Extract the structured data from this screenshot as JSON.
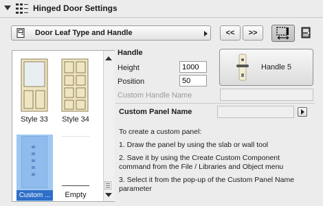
{
  "header": {
    "title": "Hinged Door Settings",
    "icon": "settings-grid-icon"
  },
  "panel": {
    "selected": "Door Leaf Type and Handle",
    "prev_label": "<<",
    "next_label": ">>"
  },
  "styles": {
    "items": [
      {
        "label": "Style 33"
      },
      {
        "label": "Style 34"
      },
      {
        "label": "Custom ..."
      },
      {
        "label": "Empty"
      }
    ],
    "selected_index": 2
  },
  "handle": {
    "section_title": "Handle",
    "height_label": "Height",
    "height_value": "1000",
    "position_label": "Position",
    "position_value": "50",
    "custom_name_label": "Custom Handle Name",
    "custom_name_value": "",
    "preview_label": "Handle 5"
  },
  "custom_panel": {
    "title": "Custom Panel Name",
    "value": "",
    "intro": "To create a custom panel:",
    "step1": "1. Draw the panel by using the slab or wall tool",
    "step2a": "2. Save it by using the Create Custom Component",
    "step2b": "command from the File / Libraries and Object menu",
    "step3a": "3. Select it from the pop-up of the Custom Panel Name",
    "step3b": "parameter"
  },
  "colors": {
    "selection": "#2e6fc9",
    "selection_light": "#9ec8f2",
    "door_wood": "#efe5c2"
  }
}
